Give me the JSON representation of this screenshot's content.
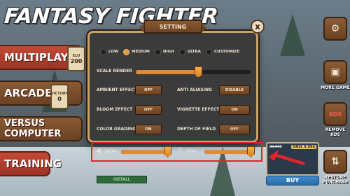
{
  "game": {
    "title": "FANTASY FIGHTER"
  },
  "menu": {
    "items": [
      {
        "label": "MULTIPLAYER",
        "badge": {
          "label": "ELO",
          "value": "200"
        }
      },
      {
        "label": "ARCADE",
        "badge": {
          "label": "VICTORY",
          "value": "0"
        }
      },
      {
        "label": "VERSUS COMPUTER"
      },
      {
        "label": "TRAINING"
      }
    ],
    "install_label": "INSTALL"
  },
  "sidebar": {
    "items": [
      {
        "icon": "gear-icon",
        "label": ""
      },
      {
        "icon": "gamepad-icon",
        "label": "MORE GAME"
      },
      {
        "icon": "no-ads-icon",
        "label": "REMOVE ADS"
      },
      {
        "icon": "restore-icon",
        "label": "RESTORE PURCHASE"
      }
    ]
  },
  "store": {
    "old_price": "20,000",
    "price": "ONLY 9.99$",
    "buy_label": "BUY"
  },
  "settings": {
    "title": "SETTING",
    "close_label": "x",
    "quality": {
      "options": [
        "LOW",
        "MEDIUM",
        "HIGH",
        "ULTRA",
        "CUSTOMIZE"
      ],
      "selected": "MEDIUM"
    },
    "scale_render": {
      "label": "SCALE RENDER",
      "value": 0.55
    },
    "toggles": [
      {
        "label": "AMBIENT EFFECT",
        "value": "OFF"
      },
      {
        "label": "ANTI ALIASING",
        "value": "DISABLE"
      },
      {
        "label": "BLOOM EFFECT",
        "value": "OFF"
      },
      {
        "label": "VIGNETTE EFFECT",
        "value": "ON"
      },
      {
        "label": "COLOR GRADING",
        "value": "ON"
      },
      {
        "label": "DEPTH OF FIELD",
        "value": "OFF"
      }
    ],
    "audio": {
      "bgm": {
        "label": "BGM",
        "value": 1.0
      },
      "sfx": {
        "label": "SFX",
        "value": 1.0
      }
    }
  },
  "colors": {
    "accent": "#e08a35",
    "highlight": "#e2242b",
    "wood": "#8a5a32",
    "menu_red": "#c34a35"
  }
}
